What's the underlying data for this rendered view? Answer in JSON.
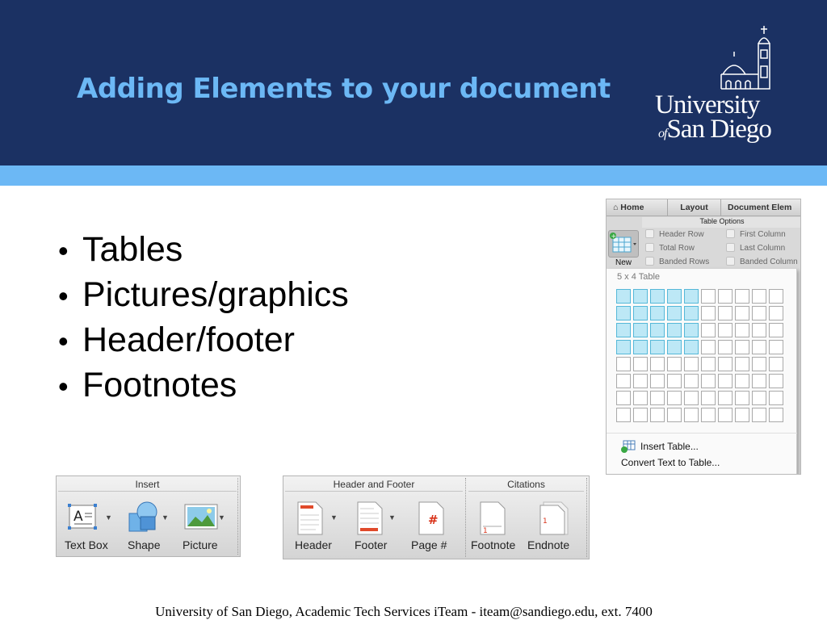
{
  "slide": {
    "title": "Adding Elements to your document",
    "logo": {
      "line1": "University",
      "of": "of",
      "line2": "San Diego"
    },
    "bullets": [
      "Tables",
      "Pictures/graphics",
      "Header/footer",
      "Footnotes"
    ],
    "footer": "University of San Diego, Academic Tech Services iTeam - iteam@sandiego.edu, ext. 7400"
  },
  "table_picker": {
    "tabs": [
      "Home",
      "Layout",
      "Document Elem"
    ],
    "options_header": "Table Options",
    "options": [
      "Header Row",
      "First Column",
      "Total Row",
      "Last Column",
      "Banded Rows",
      "Banded Column"
    ],
    "new_label": "New",
    "grid_caption": "5 x 4 Table",
    "grid": {
      "cols": 10,
      "rows": 8,
      "selected_cols": 5,
      "selected_rows": 4
    },
    "insert_table": "Insert Table...",
    "convert": "Convert Text to Table..."
  },
  "insert_ribbon": {
    "group": "Insert",
    "buttons": [
      "Text Box",
      "Shape",
      "Picture"
    ]
  },
  "hf_ribbon": {
    "group_hf": "Header and Footer",
    "group_cit": "Citations",
    "buttons": [
      "Header",
      "Footer",
      "Page #",
      "Footnote",
      "Endnote"
    ]
  },
  "colors": {
    "banner": "#1b3163",
    "accent": "#6cb8f5",
    "grid_selected": "#bde8f6"
  }
}
